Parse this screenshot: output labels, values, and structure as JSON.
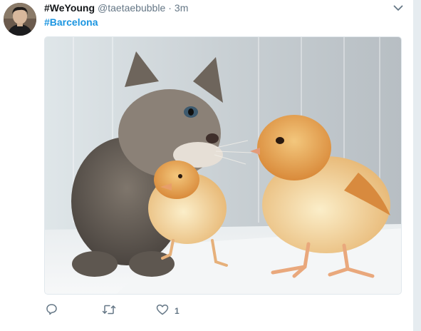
{
  "tweet": {
    "display_name": "#WeYoung",
    "handle": "@taetaebubble",
    "separator": "·",
    "time": "3m",
    "hashtag": "#Barcelona",
    "like_count": "1"
  },
  "media": {
    "description_icon": "photo"
  },
  "icons": {
    "more": "chevron-down",
    "reply": "speech-bubble",
    "retweet": "retweet-arrows",
    "like": "heart"
  },
  "colors": {
    "link": "#1b95e0",
    "name": "#14171a",
    "muted": "#657786",
    "border": "#e1e8ed"
  }
}
